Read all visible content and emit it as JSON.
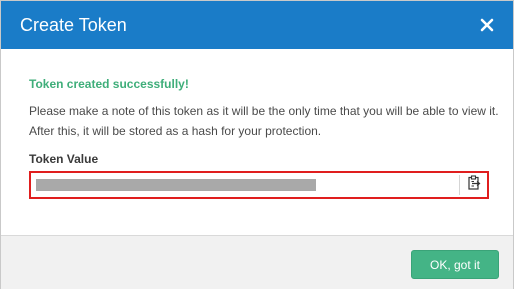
{
  "dialog": {
    "title": "Create Token",
    "close_icon": "close-icon"
  },
  "content": {
    "success_message": "Token created successfully!",
    "note_line1": "Please make a note of this token as it will be the only time that you will be able to view it.",
    "note_line2": "After this, it will be stored as a hash for your protection.",
    "token_label": "Token Value",
    "token_value_state": "redacted",
    "copy_icon": "clipboard-copy-icon"
  },
  "footer": {
    "ok_label": "OK, got it"
  },
  "colors": {
    "header": "#1a7cc8",
    "success": "#3fae7a",
    "highlight_border": "#e01e1e",
    "ok_button": "#44b486"
  }
}
